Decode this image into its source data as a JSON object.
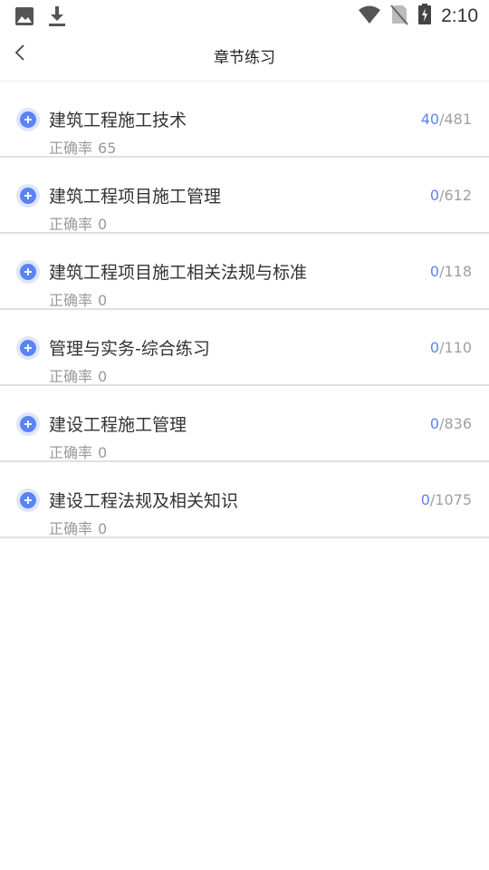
{
  "status_bar": {
    "time": "2:10",
    "icons": [
      "image-icon",
      "download-icon",
      "wifi-icon",
      "no-sim-icon",
      "battery-charging-icon"
    ]
  },
  "header": {
    "title": "章节练习"
  },
  "accuracy_label": "正确率",
  "chapters": [
    {
      "title": "建筑工程施工技术",
      "accuracy": "65",
      "done": "40",
      "total": "/481"
    },
    {
      "title": "建筑工程项目施工管理",
      "accuracy": "0",
      "done": "0",
      "total": "/612"
    },
    {
      "title": "建筑工程项目施工相关法规与标准",
      "accuracy": "0",
      "done": "0",
      "total": "/118"
    },
    {
      "title": "管理与实务-综合练习",
      "accuracy": "0",
      "done": "0",
      "total": "/110"
    },
    {
      "title": "建设工程施工管理",
      "accuracy": "0",
      "done": "0",
      "total": "/836"
    },
    {
      "title": "建设工程法规及相关知识",
      "accuracy": "0",
      "done": "0",
      "total": "/1075"
    }
  ],
  "colors": {
    "accent": "#5b84f3",
    "icon_bg": "#dfe6fb",
    "divider": "#e0e0e0"
  }
}
